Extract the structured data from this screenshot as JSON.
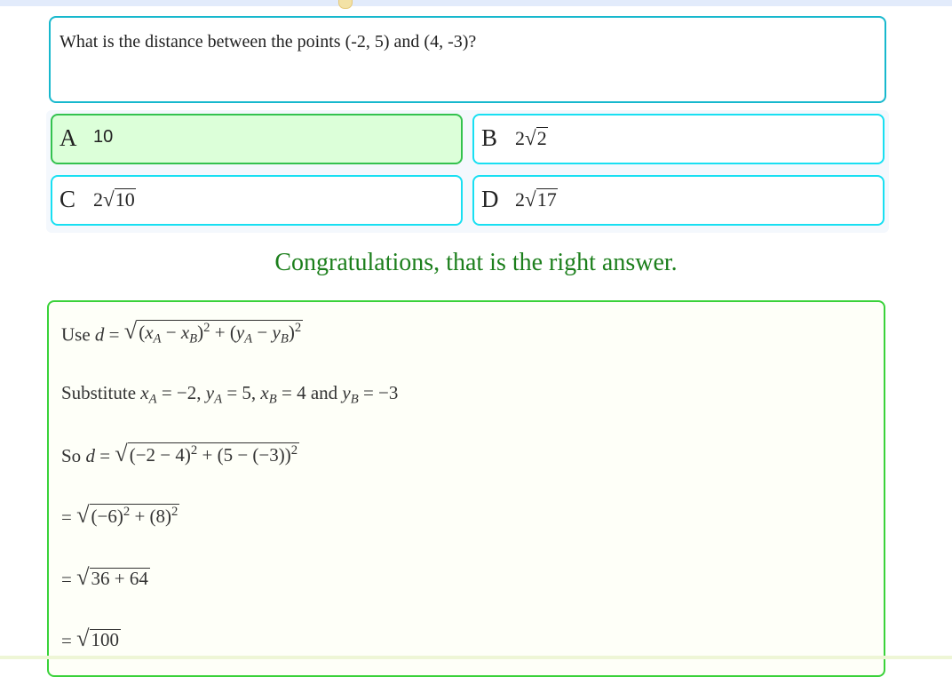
{
  "question": {
    "text": "What is the distance between the points (-2, 5) and (4, -3)?"
  },
  "options": [
    {
      "letter": "A",
      "value": "10",
      "selected": true
    },
    {
      "letter": "B",
      "coefficient": "2",
      "radicand": "2",
      "selected": false
    },
    {
      "letter": "C",
      "coefficient": "2",
      "radicand": "10",
      "selected": false
    },
    {
      "letter": "D",
      "coefficient": "2",
      "radicand": "17",
      "selected": false
    }
  ],
  "feedback": {
    "text": "Congratulations, that is the right answer."
  },
  "solution": {
    "step1_prefix": "Use",
    "step2_prefix": "Substitute",
    "step2_and": "and",
    "step3_prefix": "So",
    "radicand_5": "36 + 64",
    "radicand_6": "100"
  },
  "colors": {
    "correct_border": "#33c24e",
    "correct_bg": "#dcffd9",
    "option_border": "#18dff2",
    "question_border": "#17b8cd",
    "feedback": "#1c7f1c"
  }
}
